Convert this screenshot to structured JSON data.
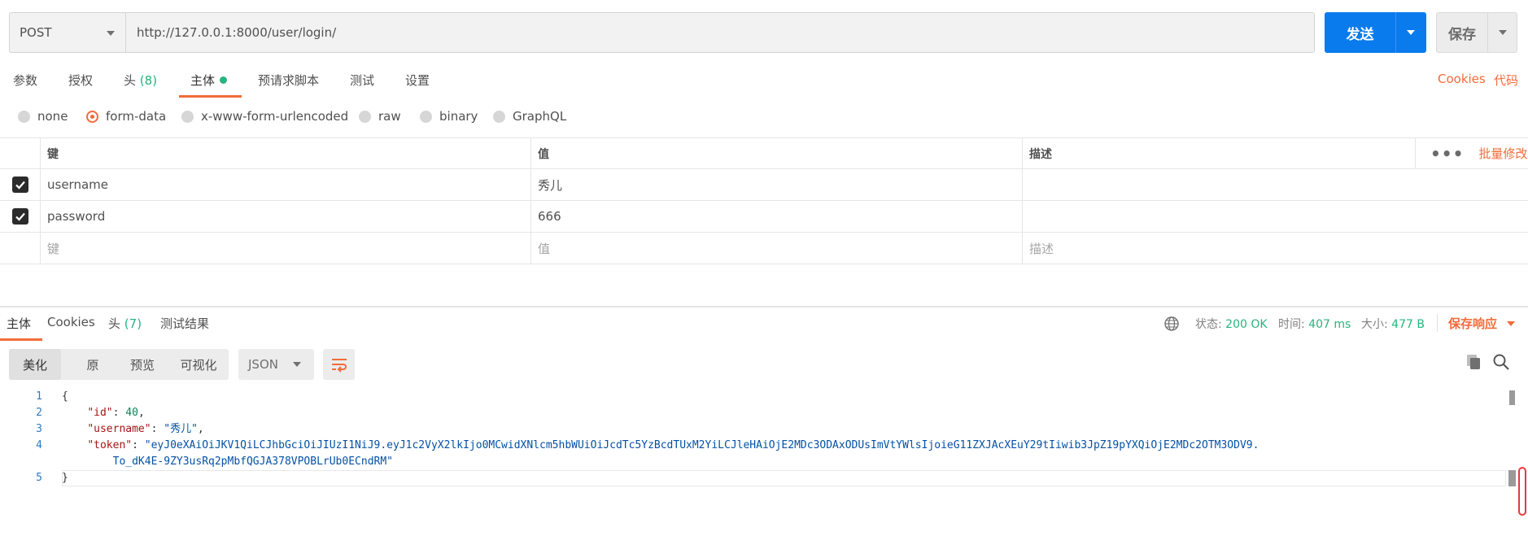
{
  "request": {
    "method": "POST",
    "url": "http://127.0.0.1:8000/user/login/",
    "send_label": "发送",
    "save_label": "保存"
  },
  "request_tabs": {
    "params": "参数",
    "auth": "授权",
    "headers": "头",
    "headers_count": "(8)",
    "body": "主体",
    "prescript": "预请求脚本",
    "tests": "测试",
    "settings": "设置",
    "cookies": "Cookies",
    "code": "代码"
  },
  "body_types": {
    "options": [
      "none",
      "form-data",
      "x-www-form-urlencoded",
      "raw",
      "binary",
      "GraphQL"
    ],
    "selected": "form-data"
  },
  "kv_table": {
    "headers": {
      "key": "键",
      "value": "值",
      "description": "描述",
      "bulk_edit": "批量修改",
      "more": "•••"
    },
    "rows": [
      {
        "checked": true,
        "key": "username",
        "value": "秀儿",
        "description": ""
      },
      {
        "checked": true,
        "key": "password",
        "value": "666",
        "description": ""
      }
    ],
    "placeholder": {
      "key": "键",
      "value": "值",
      "description": "描述"
    }
  },
  "response_tabs": {
    "body": "主体",
    "cookies": "Cookies",
    "headers": "头",
    "headers_count": "(7)",
    "test_results": "测试结果"
  },
  "response_status": {
    "status_label": "状态:",
    "status_value": "200 OK",
    "time_label": "时间:",
    "time_value": "407 ms",
    "size_label": "大小:",
    "size_value": "477 B",
    "save_response": "保存响应"
  },
  "view_modes": {
    "pretty": "美化",
    "raw": "原",
    "preview": "预览",
    "visualize": "可视化",
    "format": "JSON"
  },
  "response_body": {
    "line_numbers": [
      "1",
      "2",
      "3",
      "4",
      "5"
    ],
    "open_brace": "{",
    "close_brace": "}",
    "id_key": "\"id\"",
    "id_value": "40",
    "username_key": "\"username\"",
    "username_value": "\"秀儿\"",
    "token_key": "\"token\"",
    "token_value_part1": "\"eyJ0eXAiOiJKV1QiLCJhbGciOiJIUzI1NiJ9.eyJ1c2VyX2lkIjo0MCwidXNlcm5hbWUiOiJcdTc5YzBcdTUxM2YiLCJleHAiOjE2MDc3ODAxODUsImVtYWlsIjoieG11ZXJAcXEuY29tIiwib3JpZ19pYXQiOjE2MDc2OTM3ODV9.",
    "token_value_part2": "To_dK4E-9ZY3usRq2pMbfQGJA378VPOBLrUb0ECndRM\""
  },
  "colors": {
    "accent": "#f26b3a",
    "primary": "#097bed",
    "success": "#26b47f"
  }
}
